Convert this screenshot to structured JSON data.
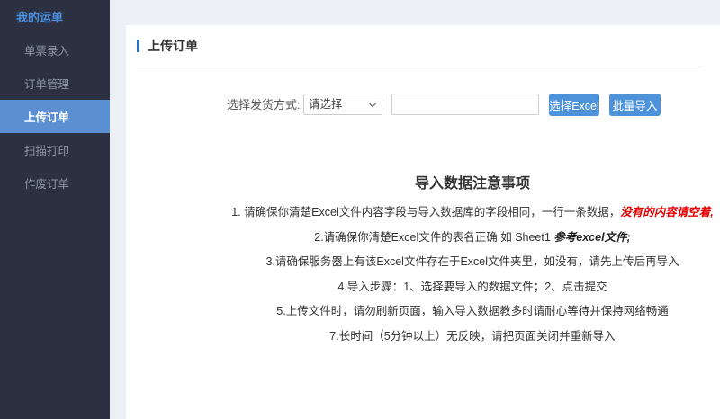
{
  "sidebar": {
    "header": "我的运单",
    "items": [
      {
        "label": "单票录入",
        "active": false
      },
      {
        "label": "订单管理",
        "active": false
      },
      {
        "label": "上传订单",
        "active": true
      },
      {
        "label": "扫描打印",
        "active": false
      },
      {
        "label": "作废订单",
        "active": false
      }
    ]
  },
  "panel": {
    "title": "上传订单"
  },
  "form": {
    "label": "选择发货方式:",
    "select_value": "请选择",
    "input_value": "",
    "choose_excel_button": "选择Excel",
    "batch_import_button": "批量导入"
  },
  "notice": {
    "title": "导入数据注意事项",
    "lines": [
      {
        "text": "1. 请确保你清楚Excel文件内容字段与导入数据库的字段相同，一行一条数据，",
        "emphasis": "没有的内容请空着,"
      },
      {
        "text": "2.请确保你清楚Excel文件的表名正确 如 Sheet1 ",
        "emphasis": "参考excel文件;"
      },
      {
        "text": "3.请确保服务器上有该Excel文件存在于Excel文件夹里，如没有，请先上传后再导入"
      },
      {
        "text": "4.导入步骤：1、选择要导入的数据文件；2、点击提交"
      },
      {
        "text": "5.上传文件时，请勿刷新页面，输入导入数据教多时请耐心等待并保持网络畅通"
      },
      {
        "text": "7.长时间（5分钟以上）无反映，请把页面关闭并重新导入"
      }
    ]
  },
  "colors": {
    "sidebar_bg": "#2b3140",
    "sidebar_header_color": "#4a8fe0",
    "sidebar_item_color": "#8d95a6",
    "sidebar_active_bg": "#5a8fd2",
    "main_bg": "#edf0f5",
    "accent_blue": "#2e6fc0",
    "button_bg": "#4e93d9",
    "warn_red": "#e60000"
  }
}
